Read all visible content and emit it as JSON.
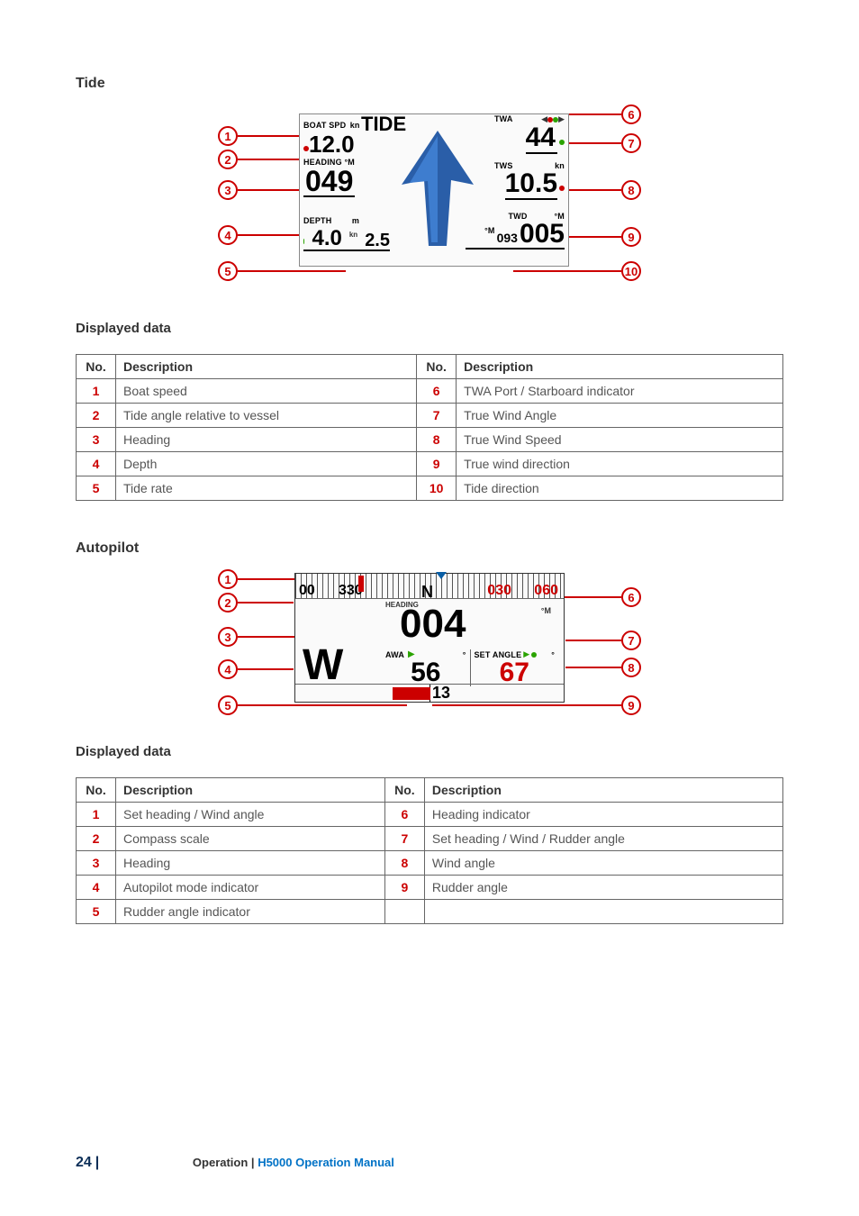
{
  "sections": {
    "tide": {
      "title": "Tide",
      "table_title": "Displayed data",
      "diagram": {
        "tide_label": "TIDE",
        "boat_spd_label": "BOAT SPD",
        "boat_spd_unit": "kn",
        "boat_spd_val": "12.0",
        "heading_label": "HEADING °M",
        "heading_val": "049",
        "depth_label": "DEPTH",
        "depth_unit": "m",
        "depth_val": "4.0",
        "tide_rate_unit": "kn",
        "tide_rate_val": "2.5",
        "twa_label": "TWA",
        "twa_val": "44",
        "tws_label": "TWS",
        "tws_unit": "kn",
        "tws_val": "10.5",
        "twd_label": "TWD",
        "twd_unit": "°M",
        "twd_val": "005",
        "tide_dir_small": "093",
        "tide_dir_unit": "°M"
      },
      "left_rows": [
        {
          "n": "1",
          "d": "Boat speed"
        },
        {
          "n": "2",
          "d": "Tide angle relative to vessel"
        },
        {
          "n": "3",
          "d": "Heading"
        },
        {
          "n": "4",
          "d": "Depth"
        },
        {
          "n": "5",
          "d": "Tide rate"
        }
      ],
      "right_rows": [
        {
          "n": "6",
          "d": "TWA Port / Starboard indicator"
        },
        {
          "n": "7",
          "d": "True Wind Angle"
        },
        {
          "n": "8",
          "d": "True Wind Speed"
        },
        {
          "n": "9",
          "d": "True wind direction"
        },
        {
          "n": "10",
          "d": "Tide direction"
        }
      ],
      "headers": {
        "no": "No.",
        "desc": "Description"
      }
    },
    "autopilot": {
      "title": "Autopilot",
      "table_title": "Displayed data",
      "diagram": {
        "compass_ticks": [
          "00",
          "330",
          "N",
          "030",
          "060"
        ],
        "heading_label": "HEADING",
        "heading_unit": "°M",
        "heading_val": "004",
        "mode": "W",
        "awa_label": "AWA",
        "awa_unit": "°",
        "awa_val": "56",
        "set_label": "SET ANGLE",
        "set_unit": "°",
        "set_val": "67",
        "rudder_val": "13"
      },
      "left_rows": [
        {
          "n": "1",
          "d": "Set heading / Wind angle"
        },
        {
          "n": "2",
          "d": "Compass scale"
        },
        {
          "n": "3",
          "d": "Heading"
        },
        {
          "n": "4",
          "d": "Autopilot mode indicator"
        },
        {
          "n": "5",
          "d": "Rudder angle indicator"
        }
      ],
      "right_rows": [
        {
          "n": "6",
          "d": "Heading indicator"
        },
        {
          "n": "7",
          "d": "Set heading / Wind / Rudder angle"
        },
        {
          "n": "8",
          "d": "Wind angle"
        },
        {
          "n": "9",
          "d": "Rudder angle"
        },
        {
          "n": "",
          "d": ""
        }
      ],
      "headers": {
        "no": "No.",
        "desc": "Description"
      }
    }
  },
  "footer": {
    "page_no": "24",
    "bar": "|",
    "section": "Operation",
    "sep": " | ",
    "doc": "H5000 Operation Manual"
  }
}
